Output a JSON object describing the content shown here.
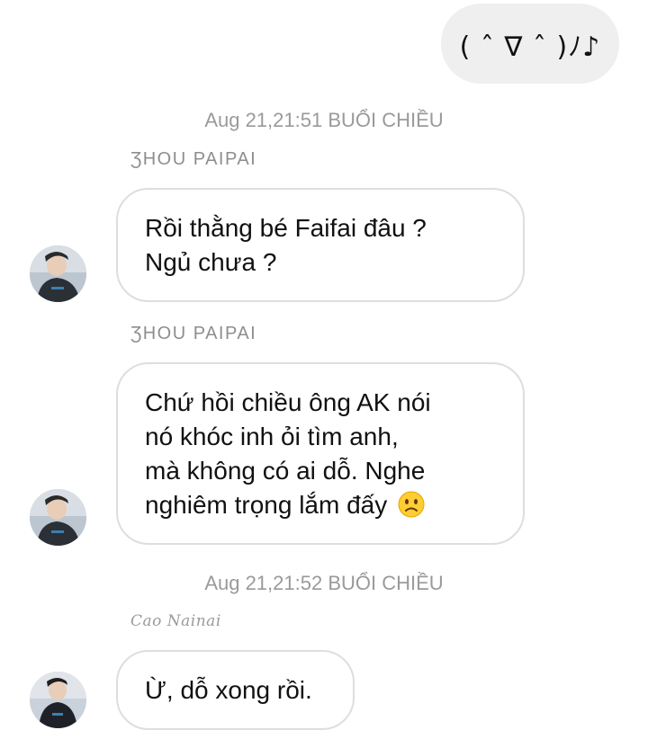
{
  "outgoing": {
    "text": "( ˆ ∇ ˆ )ﾉ♪"
  },
  "timestamps": [
    "Aug 21,21:51 BUỔI CHIỀU",
    "Aug 21,21:52 BUỔI CHIỀU"
  ],
  "messages": [
    {
      "sender": "ƷHOU PAIPAI",
      "lines": [
        "Rồi thằng bé Faifai đâu ?",
        "Ngủ chưa ?"
      ]
    },
    {
      "sender": "ƷHOU PAIPAI",
      "lines": [
        "Chứ hồi chiều ông AK nói",
        "nó khóc inh ỏi tìm anh,",
        "mà không có ai dỗ. Nghe",
        "nghiêm trọng lắm đấy"
      ],
      "emoji_icon": "worried-face-icon"
    },
    {
      "sender": "Cao Nainai",
      "lines": [
        "Ừ, dỗ xong rồi."
      ]
    }
  ]
}
